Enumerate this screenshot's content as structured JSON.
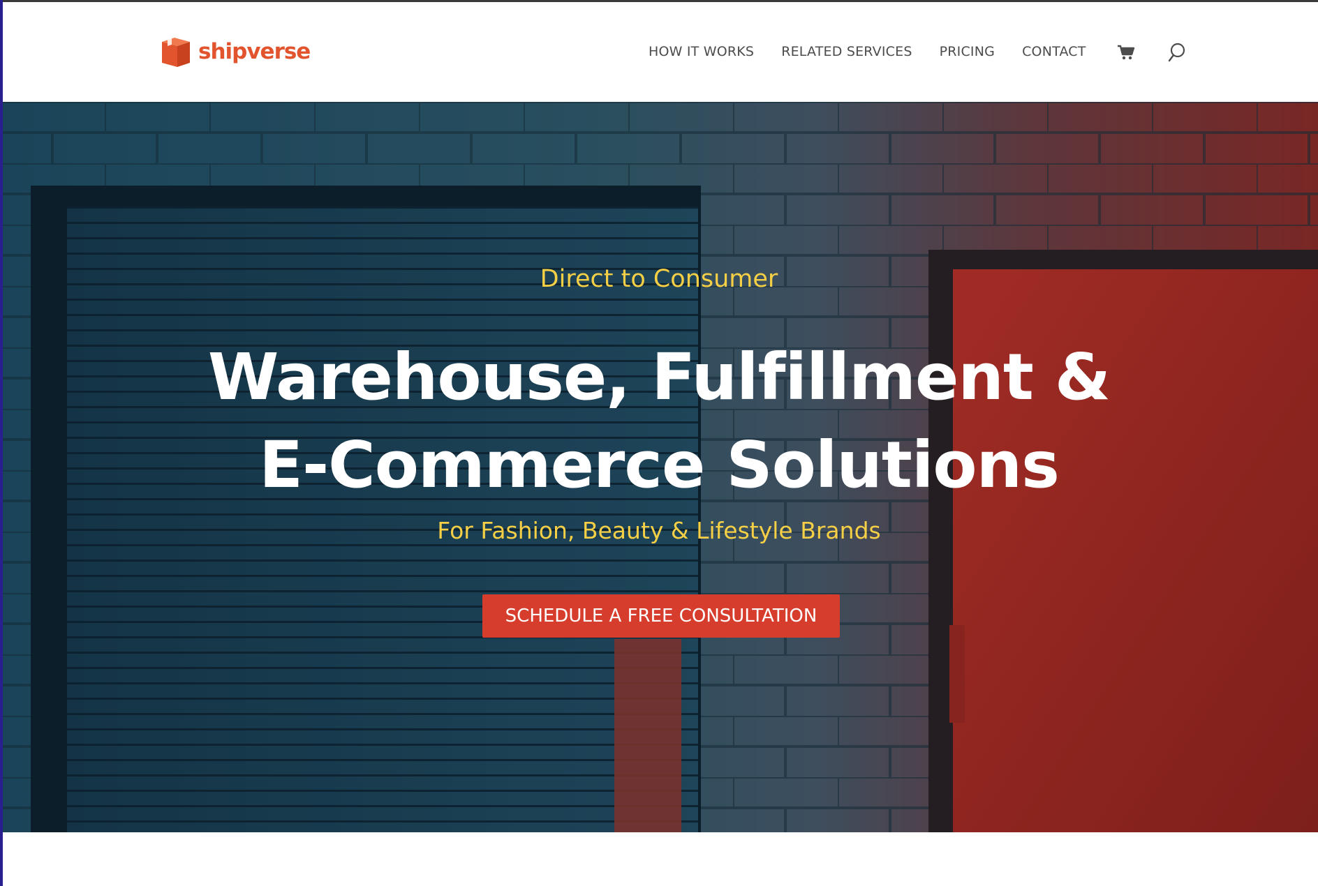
{
  "brand": {
    "name": "shipverse",
    "color": "#e2542d",
    "logo_icon": "box-icon"
  },
  "nav": {
    "items": [
      {
        "label": "HOW IT WORKS"
      },
      {
        "label": "RELATED SERVICES"
      },
      {
        "label": "PRICING"
      },
      {
        "label": "CONTACT"
      }
    ],
    "cart_icon": "cart-icon",
    "search_icon": "search-icon"
  },
  "hero": {
    "eyebrow": "Direct to Consumer",
    "headline_line1": "Warehouse, Fulfillment &",
    "headline_line2": "E-Commerce Solutions",
    "subhead": "For Fashion, Beauty & Lifestyle Brands",
    "cta_label": "SCHEDULE A FREE CONSULTATION",
    "accent_color": "#f5cf45",
    "cta_color": "#d63d2d"
  }
}
